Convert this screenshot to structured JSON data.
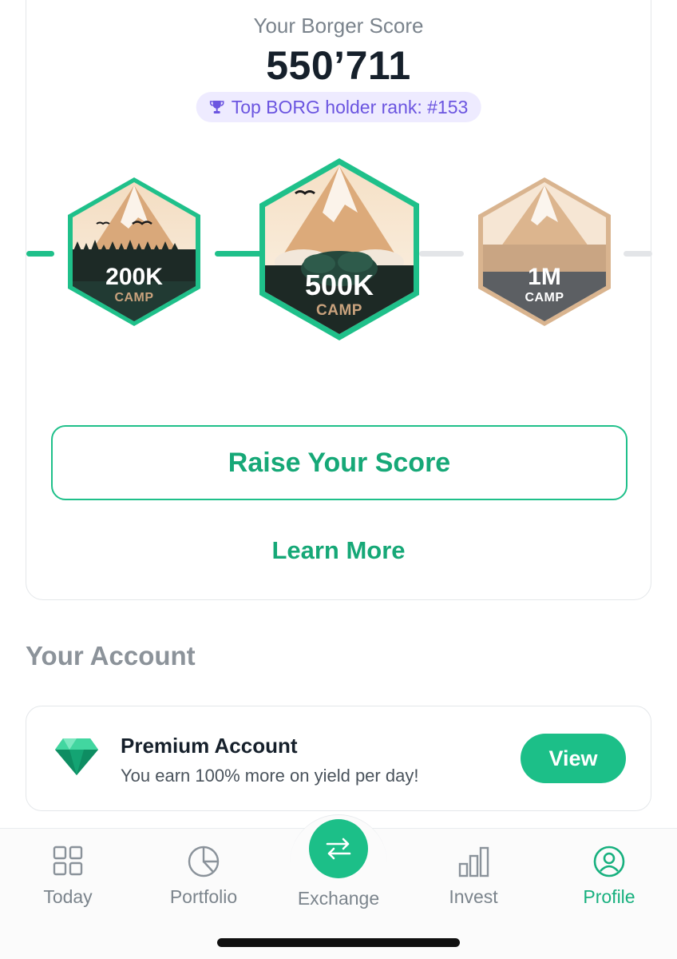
{
  "score": {
    "label": "Your Borger Score",
    "value": "550’711",
    "rank_text": "Top BORG holder rank: #153"
  },
  "badges": [
    {
      "amount": "200K",
      "sub": "CAMP",
      "state": "achieved"
    },
    {
      "amount": "500K",
      "sub": "CAMP",
      "state": "current"
    },
    {
      "amount": "1M",
      "sub": "CAMP",
      "state": "locked"
    }
  ],
  "actions": {
    "raise_label": "Raise Your Score",
    "learn_more_label": "Learn More"
  },
  "account": {
    "section_title": "Your Account",
    "premium_title": "Premium Account",
    "premium_subtitle": "You earn 100% more on yield per day!",
    "view_label": "View"
  },
  "tabbar": {
    "items": [
      {
        "label": "Today",
        "icon": "grid-icon",
        "active": false
      },
      {
        "label": "Portfolio",
        "icon": "pie-chart-icon",
        "active": false
      },
      {
        "label": "Exchange",
        "icon": "exchange-arrows-icon",
        "active": false
      },
      {
        "label": "Invest",
        "icon": "bar-chart-icon",
        "active": false
      },
      {
        "label": "Profile",
        "icon": "user-circle-icon",
        "active": true
      }
    ]
  },
  "colors": {
    "accent": "#1cbf88",
    "rank_pill_bg": "#eeebff",
    "rank_pill_text": "#6b55e0",
    "locked_badge": "#d9b48f"
  }
}
